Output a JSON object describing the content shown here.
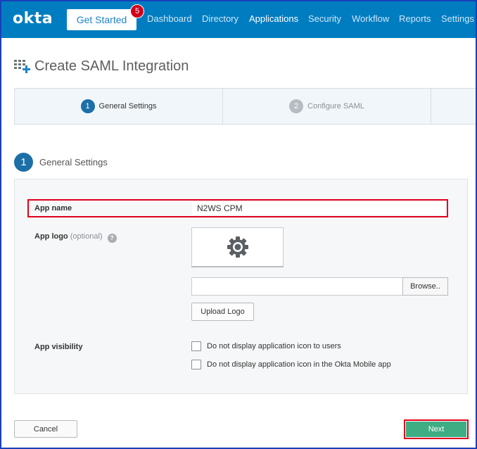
{
  "header": {
    "logo": "okta",
    "get_started": "Get Started",
    "badge_count": "5",
    "nav": [
      "Dashboard",
      "Directory",
      "Applications",
      "Security",
      "Workflow",
      "Reports",
      "Settings"
    ],
    "active_nav": "Applications"
  },
  "page": {
    "title": "Create SAML Integration"
  },
  "stepper": {
    "steps": [
      {
        "number": "1",
        "label": "General Settings",
        "state": "active"
      },
      {
        "number": "2",
        "label": "Configure SAML",
        "state": "inactive"
      }
    ]
  },
  "section": {
    "number": "1",
    "title": "General Settings"
  },
  "form": {
    "app_name_label": "App name",
    "app_name_value": "N2WS CPM",
    "app_logo_label": "App logo",
    "app_logo_optional": "(optional)",
    "help_glyph": "?",
    "browse_label": "Browse..",
    "upload_logo_label": "Upload Logo",
    "visibility_label": "App visibility",
    "visibility_options": [
      "Do not display application icon to users",
      "Do not display application icon in the Okta Mobile app"
    ]
  },
  "footer": {
    "cancel_label": "Cancel",
    "next_label": "Next"
  },
  "colors": {
    "header_bg": "#007dc1",
    "badge": "#d0021b",
    "step_active": "#1d6fa8",
    "next_button": "#3ead84",
    "highlight_outline": "#e0001b"
  },
  "icons": {
    "title_icon": "grid-plus-icon",
    "logo_placeholder": "gear-icon"
  }
}
